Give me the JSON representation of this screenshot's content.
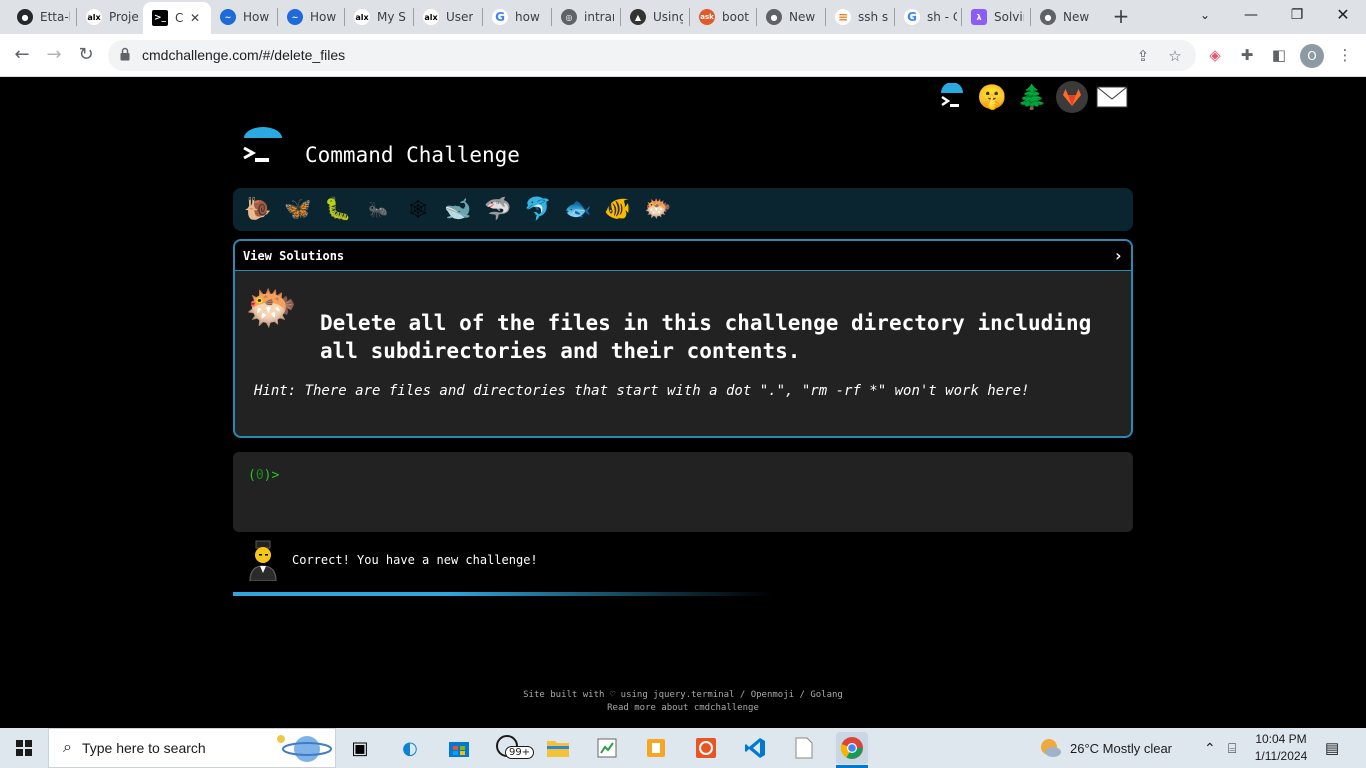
{
  "browser": {
    "tabs": [
      {
        "label": "Etta-l",
        "icon": "github-icon",
        "color": "#24292e"
      },
      {
        "label": "Proje",
        "icon": "alx-icon",
        "color": "#ffffff"
      },
      {
        "label": "C",
        "icon": "terminal-icon",
        "color": "#000000",
        "active": true
      },
      {
        "label": "How",
        "icon": "confluence-icon",
        "color": "#1e6ad8"
      },
      {
        "label": "How",
        "icon": "confluence-icon",
        "color": "#1e6ad8"
      },
      {
        "label": "My S",
        "icon": "alx-icon",
        "color": "#ffffff"
      },
      {
        "label": "User",
        "icon": "alx-icon",
        "color": "#ffffff"
      },
      {
        "label": "how",
        "icon": "google-icon",
        "color": "#ffffff"
      },
      {
        "label": "intrar",
        "icon": "globe-icon",
        "color": "#5f6368"
      },
      {
        "label": "Using",
        "icon": "cat-icon",
        "color": "#333333"
      },
      {
        "label": "boot",
        "icon": "askubuntu-icon",
        "color": "#e25a2b"
      },
      {
        "label": "New",
        "icon": "chrome-icon",
        "color": "#5f6368"
      },
      {
        "label": "ssh sc",
        "icon": "stackoverflow-icon",
        "color": "#f48024"
      },
      {
        "label": "sh - C",
        "icon": "google-icon",
        "color": "#ffffff"
      },
      {
        "label": "Solvir",
        "icon": "lambda-icon",
        "color": "#8b5cf6"
      },
      {
        "label": "New",
        "icon": "chrome-icon",
        "color": "#5f6368"
      }
    ],
    "close_tab_glyph": "✕",
    "new_tab_glyph": "+",
    "url": "cmdchallenge.com/#/delete_files",
    "profile_initial": "O"
  },
  "page": {
    "site_title": "Command Challenge",
    "view_solutions": "View Solutions",
    "challenge_text": "Delete all of the files in this challenge directory including all subdirectories and their contents.",
    "hint_text": "Hint: There are files and directories that start with a dot \".\", \"rm -rf *\" won't work here!",
    "prompt_open": "(",
    "prompt_num": "0",
    "prompt_close": ")>",
    "result_text": "Correct! You have a new challenge!",
    "footer_line1": "Site built with ♡ using jquery.terminal / Openmoji / Golang",
    "footer_line2": "Read more about cmdchallenge",
    "progress_fraction": 0.4,
    "accent_color": "#2a8ab6"
  },
  "taskbar": {
    "search_placeholder": "Type here to search",
    "whatsapp_badge": "99+",
    "weather": "26°C  Mostly clear",
    "time": "10:04 PM",
    "date": "1/11/2024"
  }
}
